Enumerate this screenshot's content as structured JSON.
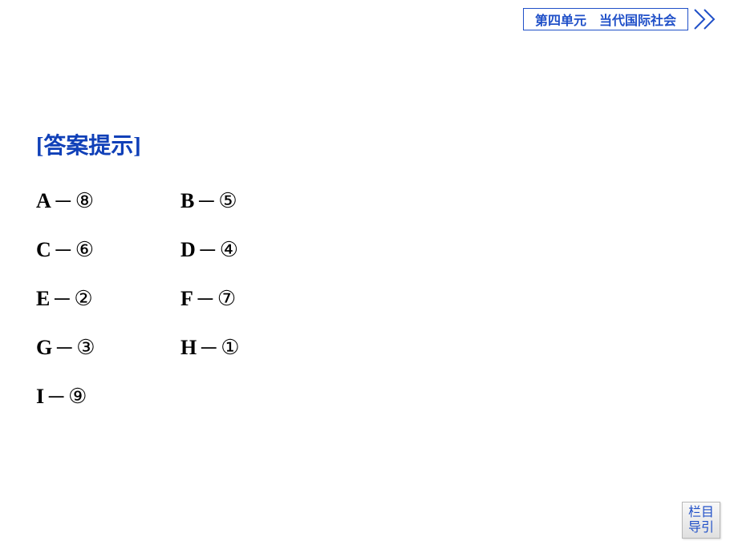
{
  "header": {
    "unit_label": "第四单元　当代国际社会"
  },
  "content": {
    "heading": "[答案提示]",
    "rows": [
      [
        {
          "letter": "A",
          "dash": "－",
          "num": "⑧"
        },
        {
          "letter": "B",
          "dash": "－",
          "num": "⑤"
        }
      ],
      [
        {
          "letter": "C",
          "dash": "－",
          "num": "⑥"
        },
        {
          "letter": "D",
          "dash": "－",
          "num": "④"
        }
      ],
      [
        {
          "letter": "E",
          "dash": "－",
          "num": "②"
        },
        {
          "letter": "F",
          "dash": "－",
          "num": "⑦"
        }
      ],
      [
        {
          "letter": "G",
          "dash": "－",
          "num": "③"
        },
        {
          "letter": "H",
          "dash": "－",
          "num": "①"
        }
      ],
      [
        {
          "letter": "I",
          "dash": "－",
          "num": "⑨"
        }
      ]
    ]
  },
  "footer": {
    "nav_line1": "栏目",
    "nav_line2": "导引"
  }
}
